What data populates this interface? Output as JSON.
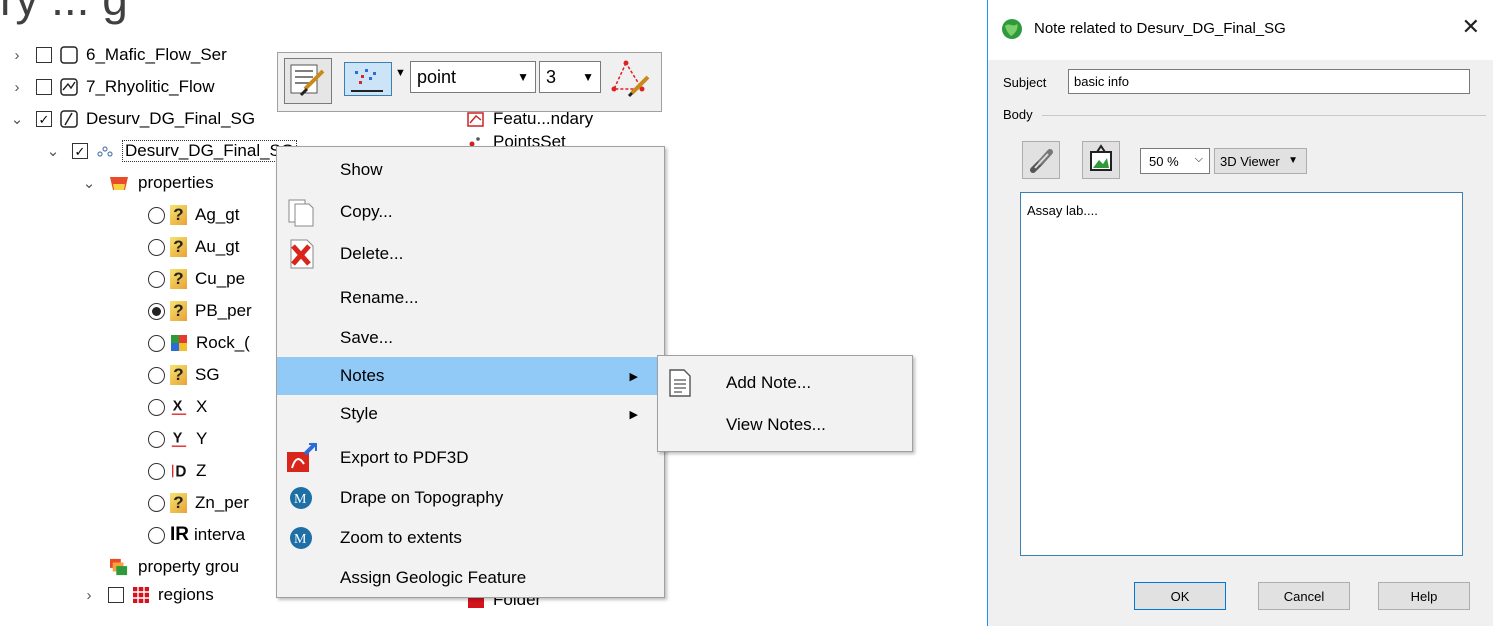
{
  "top_heading": "ry ... g",
  "tree": {
    "rows": [
      {
        "label": "6_Mafic_Flow_Ser",
        "checked": false
      },
      {
        "label": "7_Rhyolitic_Flow",
        "checked": false
      },
      {
        "label": "Desurv_DG_Final_SG",
        "checked": true
      },
      {
        "label": "Desurv_DG_Final_SG",
        "checked": true
      },
      {
        "label": "properties"
      },
      {
        "label": "Ag_gt"
      },
      {
        "label": "Au_gt"
      },
      {
        "label": "Cu_pe"
      },
      {
        "label": "PB_per",
        "selected": true
      },
      {
        "label": "Rock_("
      },
      {
        "label": "SG"
      },
      {
        "label": "X"
      },
      {
        "label": "Y"
      },
      {
        "label": "Z"
      },
      {
        "label": "Zn_per"
      },
      {
        "label": "interva"
      },
      {
        "label": "property grou"
      },
      {
        "label": "regions",
        "checked": false
      }
    ],
    "type_column": [
      "Featu...ndary",
      "PointsSet",
      "Folder"
    ]
  },
  "toolbar": {
    "mode_value": "point",
    "size_value": "3"
  },
  "context_menu": {
    "items": [
      "Show",
      "Copy...",
      "Delete...",
      "Rename...",
      "Save...",
      "Notes",
      "Style",
      "Export to PDF3D",
      "Drape on Topography",
      "Zoom to extents",
      "Assign Geologic Feature"
    ],
    "highlighted": "Notes"
  },
  "submenu": {
    "items": [
      "Add Note...",
      "View Notes..."
    ]
  },
  "dialog": {
    "title": "Note related to Desurv_DG_Final_SG",
    "subject_label": "Subject",
    "subject_value": "basic info",
    "body_label": "Body",
    "zoom_value": "50 %",
    "viewer_label": "3D Viewer",
    "body_text": "Assay lab....",
    "ok_label": "OK",
    "cancel_label": "Cancel",
    "help_label": "Help"
  },
  "colors": {
    "menu_highlight": "#91c9f7",
    "dialog_border": "#1e90ff",
    "body_border": "#3c7fb1"
  }
}
